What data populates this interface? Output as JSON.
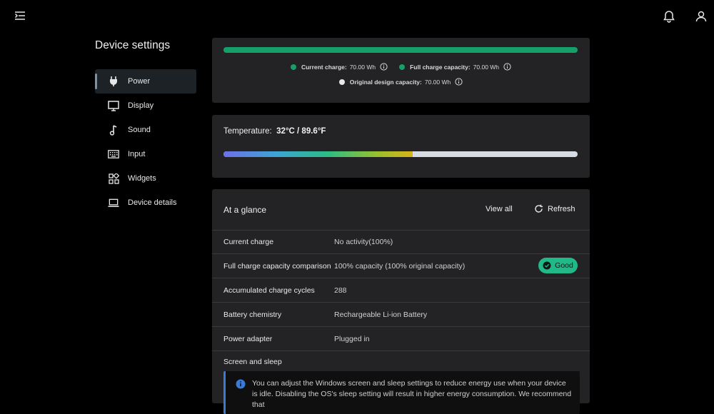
{
  "sidebar": {
    "title": "Device settings",
    "items": [
      {
        "label": "Power",
        "icon": "plug-icon",
        "active": true
      },
      {
        "label": "Display",
        "icon": "monitor-icon",
        "active": false
      },
      {
        "label": "Sound",
        "icon": "music-note-icon",
        "active": false
      },
      {
        "label": "Input",
        "icon": "keyboard-icon",
        "active": false
      },
      {
        "label": "Widgets",
        "icon": "widgets-icon",
        "active": false
      },
      {
        "label": "Device details",
        "icon": "laptop-icon",
        "active": false
      }
    ]
  },
  "capacity": {
    "current_charge_key": "Current charge:",
    "current_charge_value": "70.00 Wh",
    "full_capacity_key": "Full charge capacity:",
    "full_capacity_value": "70.00 Wh",
    "design_capacity_key": "Original design capacity:",
    "design_capacity_value": "70.00 Wh",
    "bar_fill_percent": 100,
    "colors": {
      "current": "#15a06a",
      "full": "#15a06a",
      "design": "#e8e8e8"
    }
  },
  "temperature": {
    "label": "Temperature:",
    "value": "32°C / 89.6°F",
    "level_percent": 53.5
  },
  "glance": {
    "title": "At a glance",
    "view_all": "View all",
    "refresh": "Refresh",
    "rows": [
      {
        "key": "Current charge",
        "value": "No activity(100%)"
      },
      {
        "key": "Full charge capacity comparison",
        "value": "100% capacity (100% original capacity)",
        "badge": "Good"
      },
      {
        "key": "Accumulated charge cycles",
        "value": "288"
      },
      {
        "key": "Battery chemistry",
        "value": "Rechargeable Li-ion Battery"
      },
      {
        "key": "Power adapter",
        "value": "Plugged in"
      }
    ],
    "screen_sleep_title": "Screen and sleep",
    "notice": "You can adjust the Windows screen and sleep settings to reduce energy use when your device is idle. Disabling the OS's sleep setting will result in higher energy consumption. We recommend that"
  },
  "colors": {
    "accent": "#15a06a",
    "badge": "#22b988",
    "info": "#3a7bd5"
  }
}
